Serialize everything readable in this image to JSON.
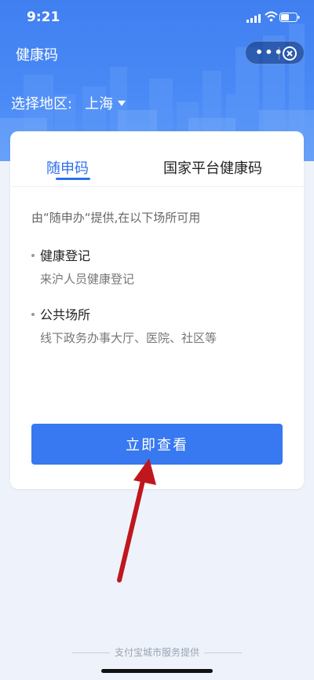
{
  "status_bar": {
    "time": "9:21"
  },
  "nav": {
    "title": "健康码",
    "more_label": "•••"
  },
  "region": {
    "label": "选择地区:",
    "city": "上海"
  },
  "tabs": [
    {
      "label": "随申码",
      "active": true
    },
    {
      "label": "国家平台健康码",
      "active": false
    }
  ],
  "content": {
    "intro": "由“随申办“提供,在以下场所可用",
    "items": [
      {
        "title": "健康登记",
        "desc": "来沪人员健康登记"
      },
      {
        "title": "公共场所",
        "desc": "线下政务办事大厅、医院、社区等"
      }
    ]
  },
  "action_button": {
    "label": "立即查看"
  },
  "footer": {
    "text": "支付宝城市服务提供"
  },
  "colors": {
    "accent": "#3878f0",
    "header": "#4a8af6",
    "arrow": "#c0171e"
  }
}
